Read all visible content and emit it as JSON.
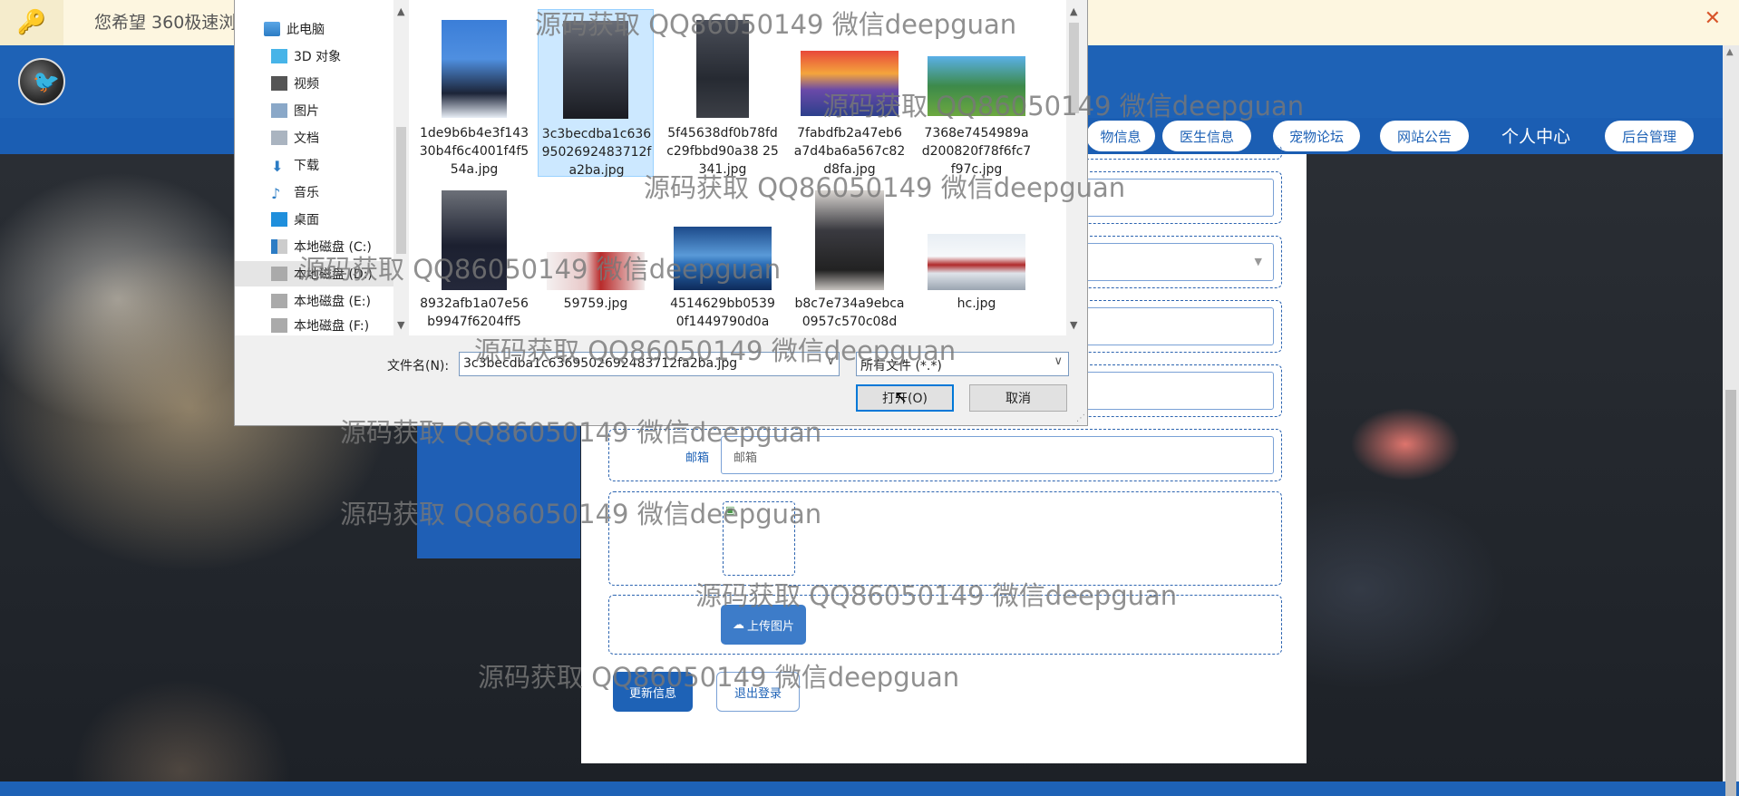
{
  "notice": {
    "text": "您希望 360极速浏"
  },
  "nav": {
    "items": [
      "物信息",
      "医生信息",
      "宠物论坛",
      "网站公告",
      "个人中心",
      "后台管理"
    ]
  },
  "form": {
    "email_label": "邮箱",
    "email_placeholder": "邮箱",
    "upload_label": "上传图片",
    "update_label": "更新信息",
    "logout_label": "退出登录"
  },
  "dialog": {
    "tree": [
      "此电脑",
      "3D 对象",
      "视频",
      "图片",
      "文档",
      "下载",
      "音乐",
      "桌面",
      "本地磁盘 (C:)",
      "本地磁盘 (D:)",
      "本地磁盘 (E:)",
      "本地磁盘 (F:)"
    ],
    "files": [
      "1de9b6b4e3f14330b4f6c4001f4f554a.jpg",
      "3c3becdba1c6369502692483712fa2ba.jpg",
      "5f45638df0b78fdc29fbbd90a38 25341.jpg",
      "7fabdfb2a47eb6a7d4ba6a567c82d8fa.jpg",
      "7368e7454989ad200820f78f6fc7f97c.jpg",
      "8932afb1a07e56b9947f6204ff5",
      "59759.jpg",
      "4514629bb05390f1449790d0a",
      "b8c7e734a9ebca0957c570c08d",
      "hc.jpg"
    ],
    "filename_label": "文件名(N):",
    "filename_value": "3c3becdba1c6369502692483712fa2ba.jpg",
    "filetype_value": "所有文件 (*.*)",
    "open_label": "打开(O)",
    "cancel_label": "取消"
  },
  "watermark": "源码获取 QQ86050149 微信deepguan",
  "colors": {
    "brand_blue": "#1e62b6",
    "selection": "#cce8ff"
  }
}
